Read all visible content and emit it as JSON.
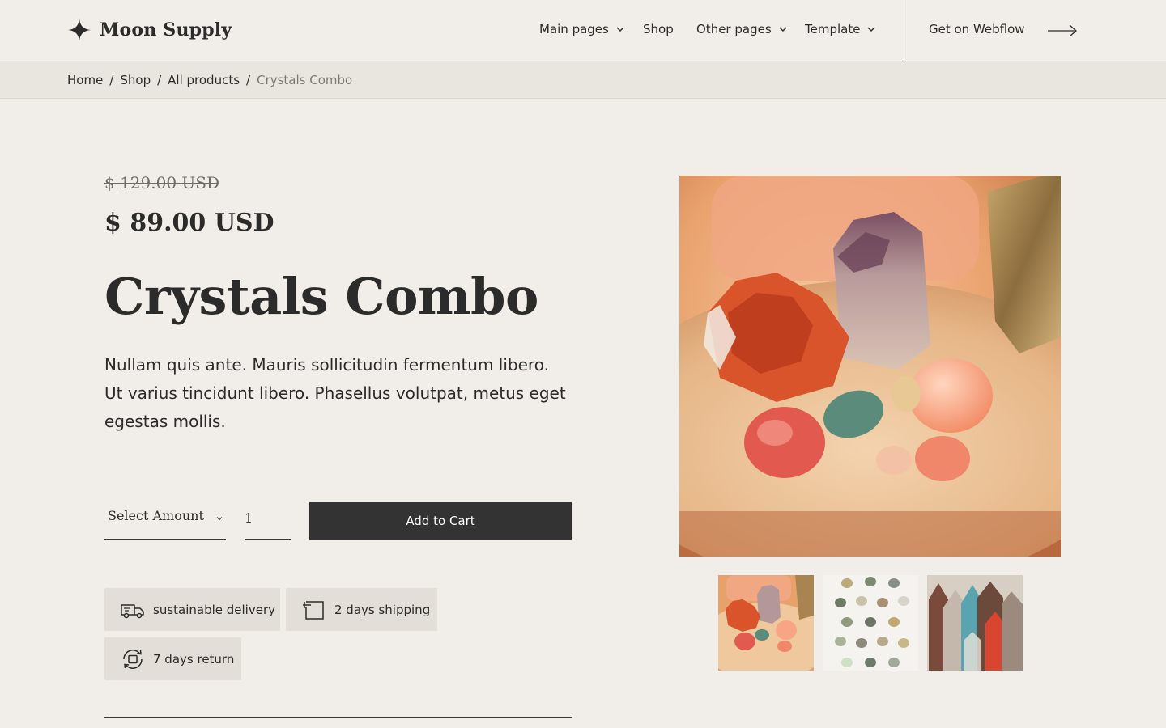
{
  "brand": {
    "name": "Moon Supply"
  },
  "nav": {
    "items": [
      {
        "label": "Main pages",
        "has_dropdown": true
      },
      {
        "label": "Shop",
        "has_dropdown": false
      },
      {
        "label": "Other pages",
        "has_dropdown": true
      },
      {
        "label": "Template",
        "has_dropdown": true
      }
    ],
    "cta_label": "Get on Webflow"
  },
  "breadcrumb": {
    "items": [
      "Home",
      "Shop",
      "All products"
    ],
    "separator": "/",
    "current": "Crystals Combo"
  },
  "product": {
    "old_price": "$ 129.00 USD",
    "price": "$ 89.00 USD",
    "title": "Crystals Combo",
    "description": "Nullam quis ante. Mauris sollicitudin fermentum libero. Ut varius tincidunt libero. Phasellus volutpat, metus eget egestas mollis.",
    "select_label": "Select Amount",
    "quantity": "1",
    "add_to_cart_label": "Add to Cart",
    "badges": [
      {
        "label": "sustainable delivery",
        "icon": "delivery-truck-icon"
      },
      {
        "label": "2 days shipping",
        "icon": "box-icon"
      },
      {
        "label": "7 days return",
        "icon": "return-icon"
      }
    ],
    "images": {
      "main": "crystals-on-wood-photo",
      "thumbnails": [
        "crystals-on-wood-photo",
        "crystal-grid-photo",
        "crystal-points-photo"
      ]
    }
  },
  "colors": {
    "background": "#f1eee9",
    "breadcrumb_bg": "#e9e5df",
    "text": "#2b2b2b",
    "button_bg": "#333333",
    "badge_bg": "#e3dfd8"
  }
}
